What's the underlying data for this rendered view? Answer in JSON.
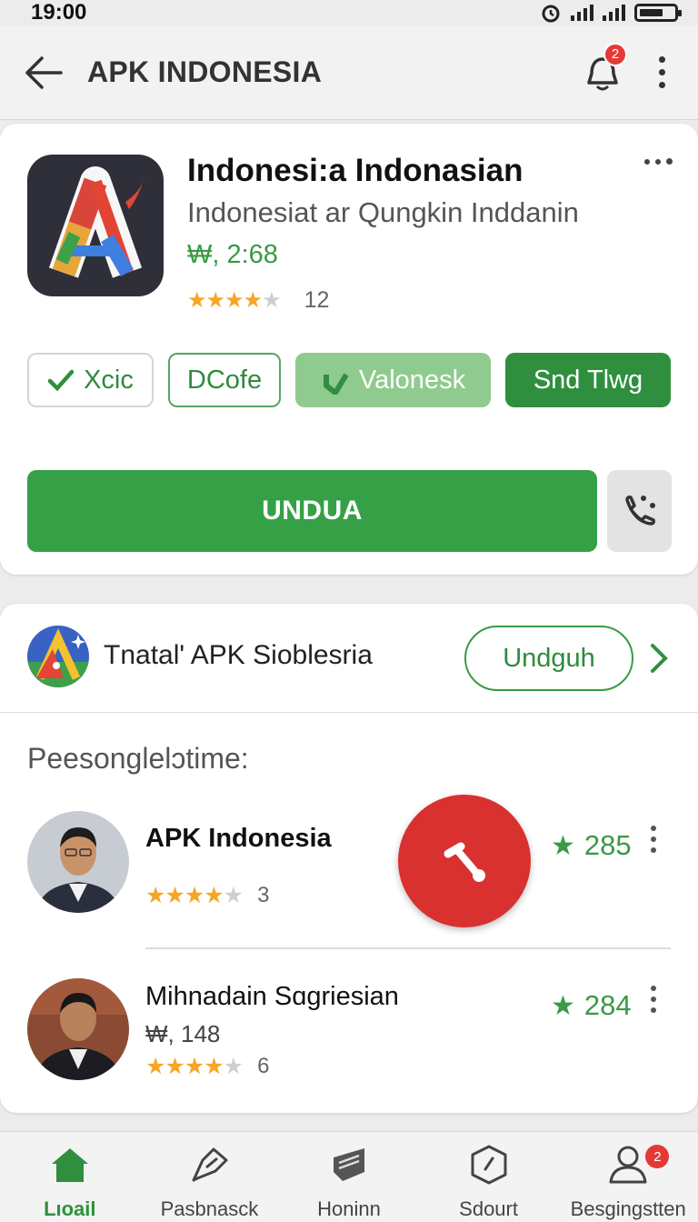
{
  "status_bar": {
    "time": "19:00"
  },
  "app_bar": {
    "title": "APK INDONESIA",
    "notification_count": "2"
  },
  "app_card": {
    "name": "Indonesi:a Indonasian",
    "subtitle": "Indonesiat ar Qungkin Inddanin",
    "price": "₩, 2:68",
    "rating_stars": 4,
    "rating_count": "12",
    "chips": [
      {
        "label": "Xcic",
        "icon": "check-icon"
      },
      {
        "label": "DCofe"
      },
      {
        "label": "Valonesk",
        "icon": "check-icon"
      },
      {
        "label": "Snd Tlwg"
      }
    ],
    "download_label": "UNDUA"
  },
  "promo": {
    "text": "Tnatal' APK Sioblesria",
    "button_label": "Undguh"
  },
  "list": {
    "section_title": "Peesonglelɔtime:",
    "people": [
      {
        "name": "APK Indonesia",
        "stars": 4,
        "review_count": "3",
        "score": "285"
      },
      {
        "name": "Mihnadain Sɑgriesian",
        "price": "₩, 148",
        "stars": 4,
        "review_count": "6",
        "score": "284"
      }
    ]
  },
  "bottom_nav": {
    "items": [
      {
        "label": "Lıoail",
        "icon": "home-icon",
        "active": true
      },
      {
        "label": "Pasbnasck",
        "icon": "bookmark-icon"
      },
      {
        "label": "Honinn",
        "icon": "store-icon"
      },
      {
        "label": "Sdourt",
        "icon": "clock-icon"
      },
      {
        "label": "Besgingstten",
        "icon": "profile-icon",
        "badge": "2"
      }
    ]
  },
  "colors": {
    "primary_green": "#35a046",
    "dark_green": "#2f8f3e",
    "fab_red": "#d93030",
    "star": "#f5a623"
  }
}
